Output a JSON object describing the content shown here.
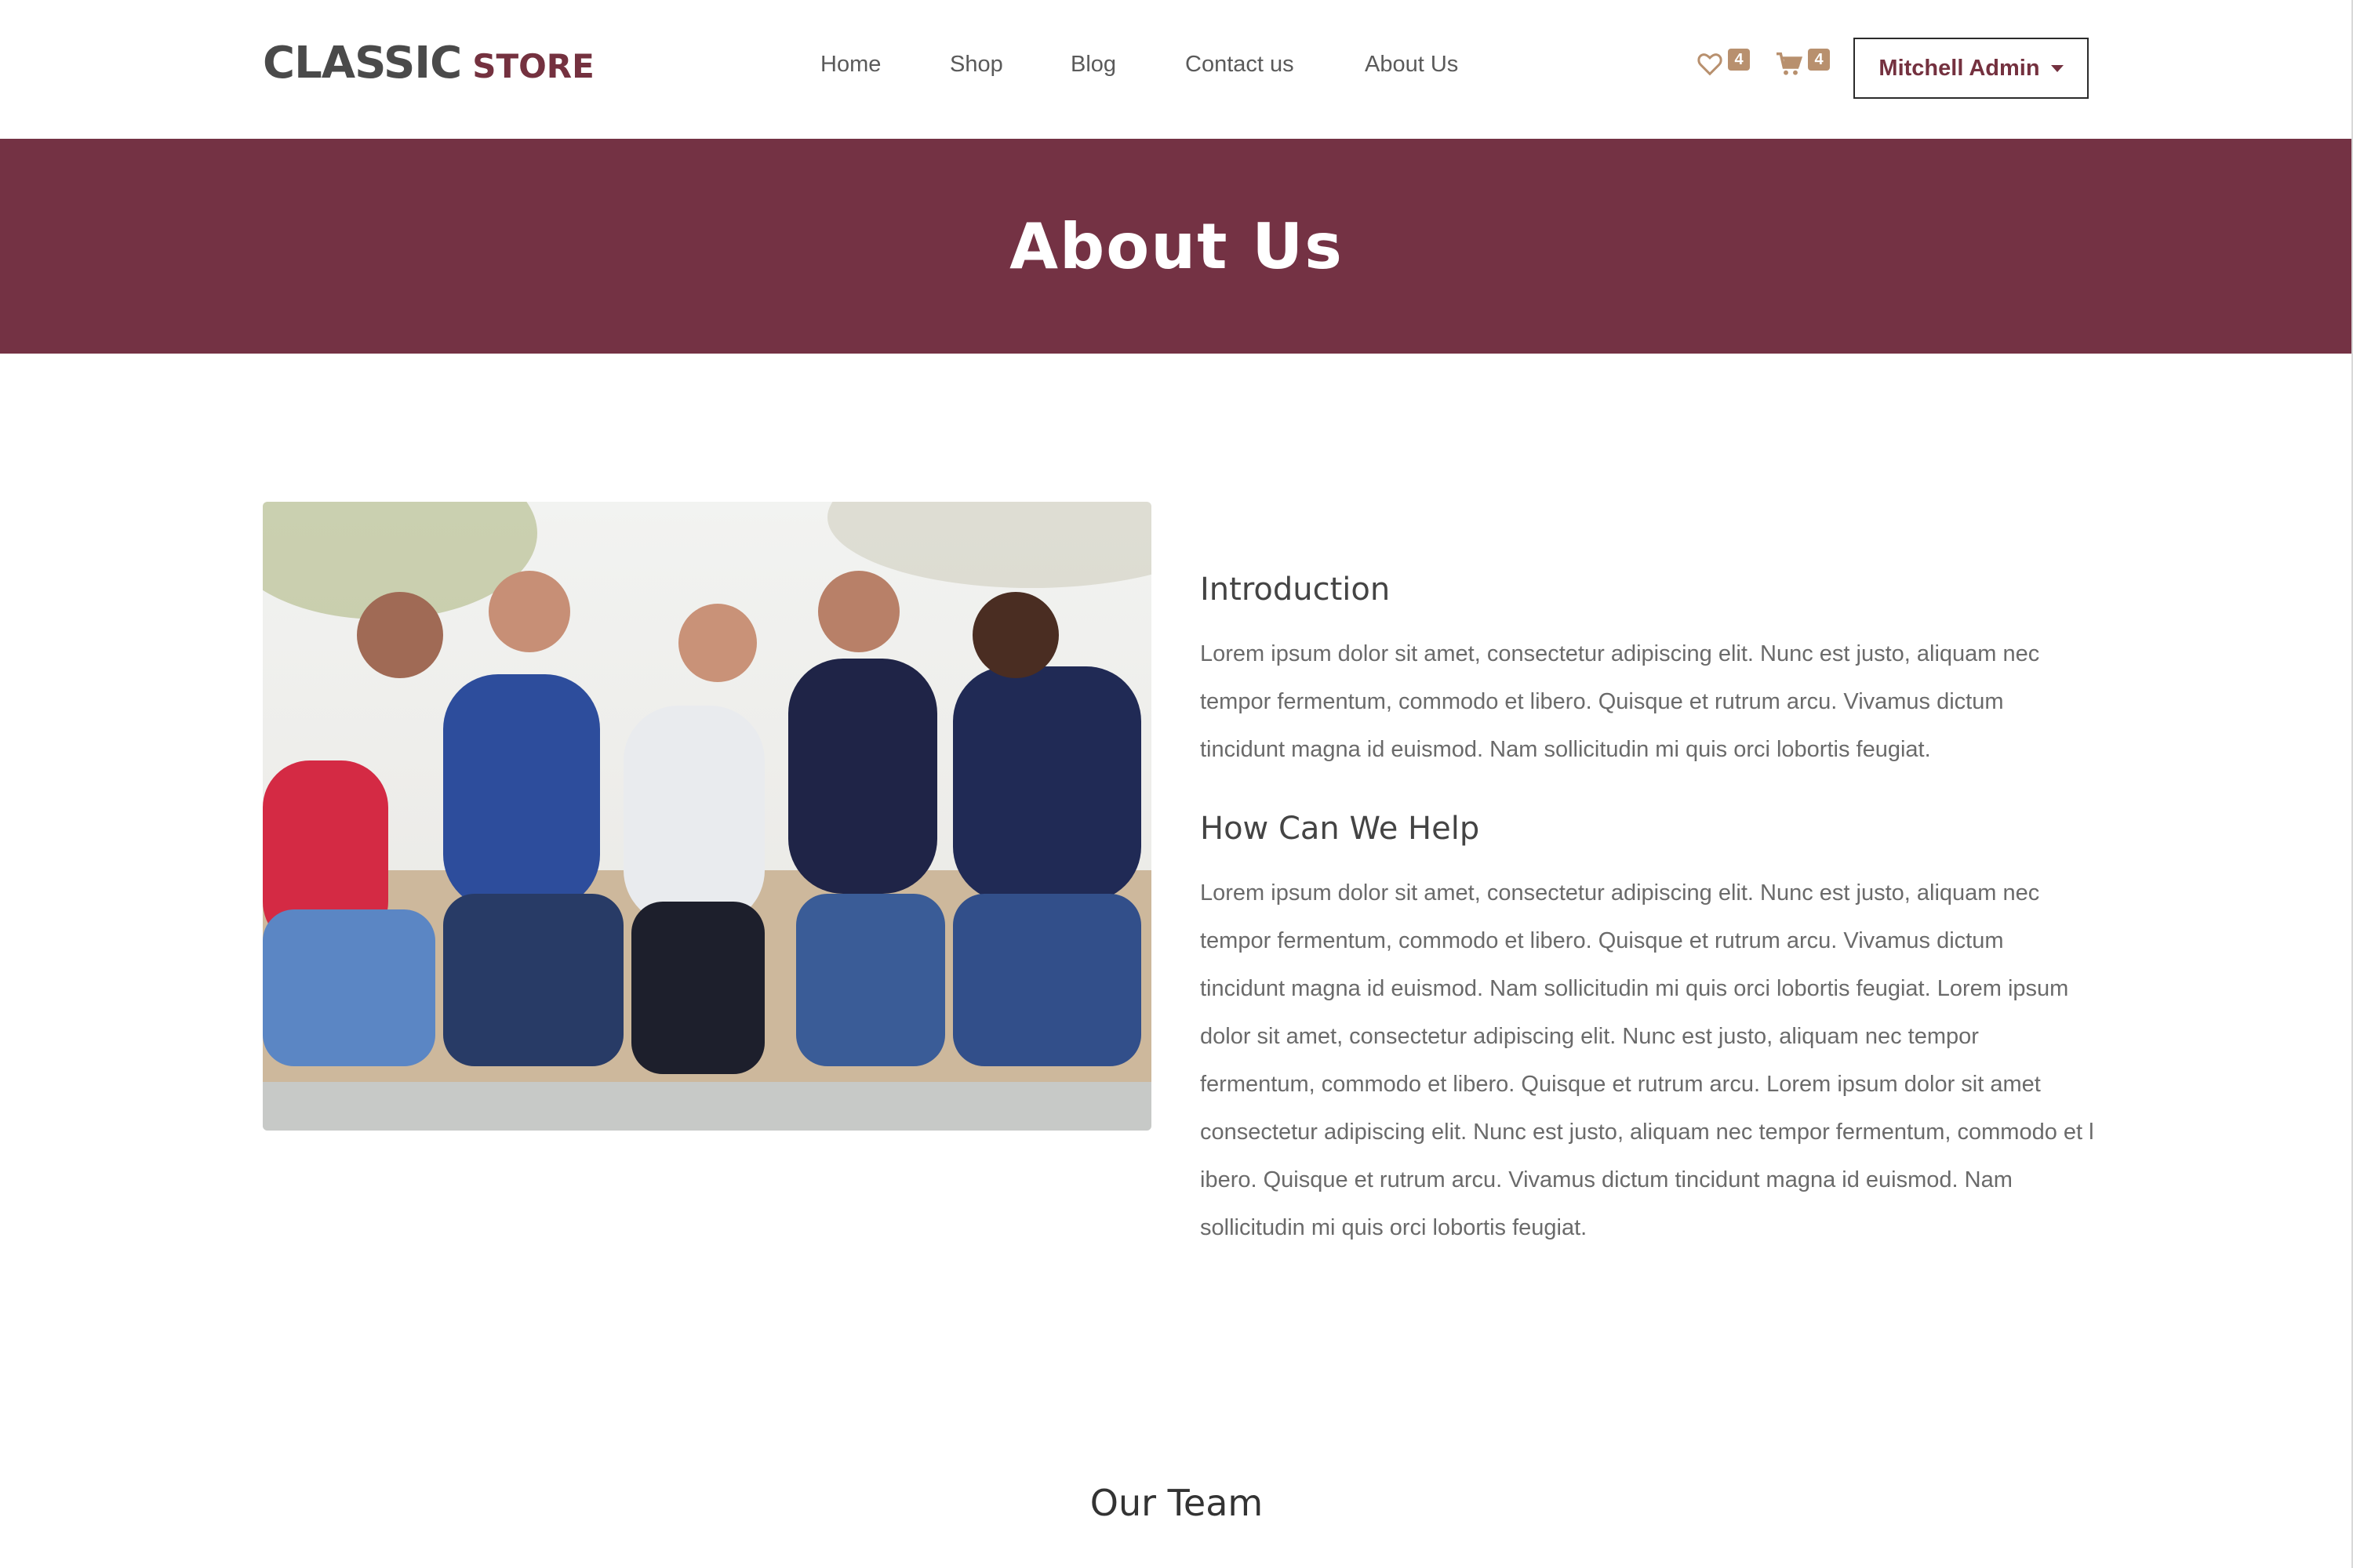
{
  "header": {
    "logo_primary": "CLASSIC",
    "logo_secondary": "STORE",
    "nav": [
      "Home",
      "Shop",
      "Blog",
      "Contact us",
      "About Us"
    ],
    "wishlist_count": "4",
    "cart_count": "4",
    "user_name": "Mitchell Admin"
  },
  "banner": {
    "title": "About Us"
  },
  "about": {
    "intro_heading": "Introduction",
    "intro_text": "Lorem ipsum dolor sit amet, consectetur adipiscing elit. Nunc est justo, aliquam nec tempor fermentum, commodo et libero. Quisque et rutrum arcu. Vivamus dictum tincidunt magna id euismod. Nam sollicitudin mi quis orci lobortis feugiat.",
    "help_heading": "How Can We Help",
    "help_text": "Lorem ipsum dolor sit amet, consectetur adipiscing elit. Nunc est justo, aliquam nec tempor fermentum, commodo et libero. Quisque et rutrum arcu. Vivamus dictum tincidunt magna id euismod. Nam sollicitudin mi quis orci lobortis feugiat. Lorem ipsum dolor sit amet, consectetur adipiscing elit. Nunc est justo, aliquam nec tempor fermentum, commodo et libero. Quisque et rutrum arcu. Lorem ipsum dolor sit amet consectetur adipiscing elit. Nunc est justo, aliquam nec tempor fermentum, commodo et l ibero. Quisque et rutrum arcu. Vivamus dictum tincidunt magna id euismod. Nam sollicitudin mi quis orci lobortis feugiat."
  },
  "team": {
    "title": "Our Team"
  },
  "colors": {
    "brand": "#743244",
    "accent": "#b8906e"
  },
  "icons": {
    "wishlist": "heart-icon",
    "cart": "cart-icon",
    "dropdown": "caret-down-icon"
  }
}
